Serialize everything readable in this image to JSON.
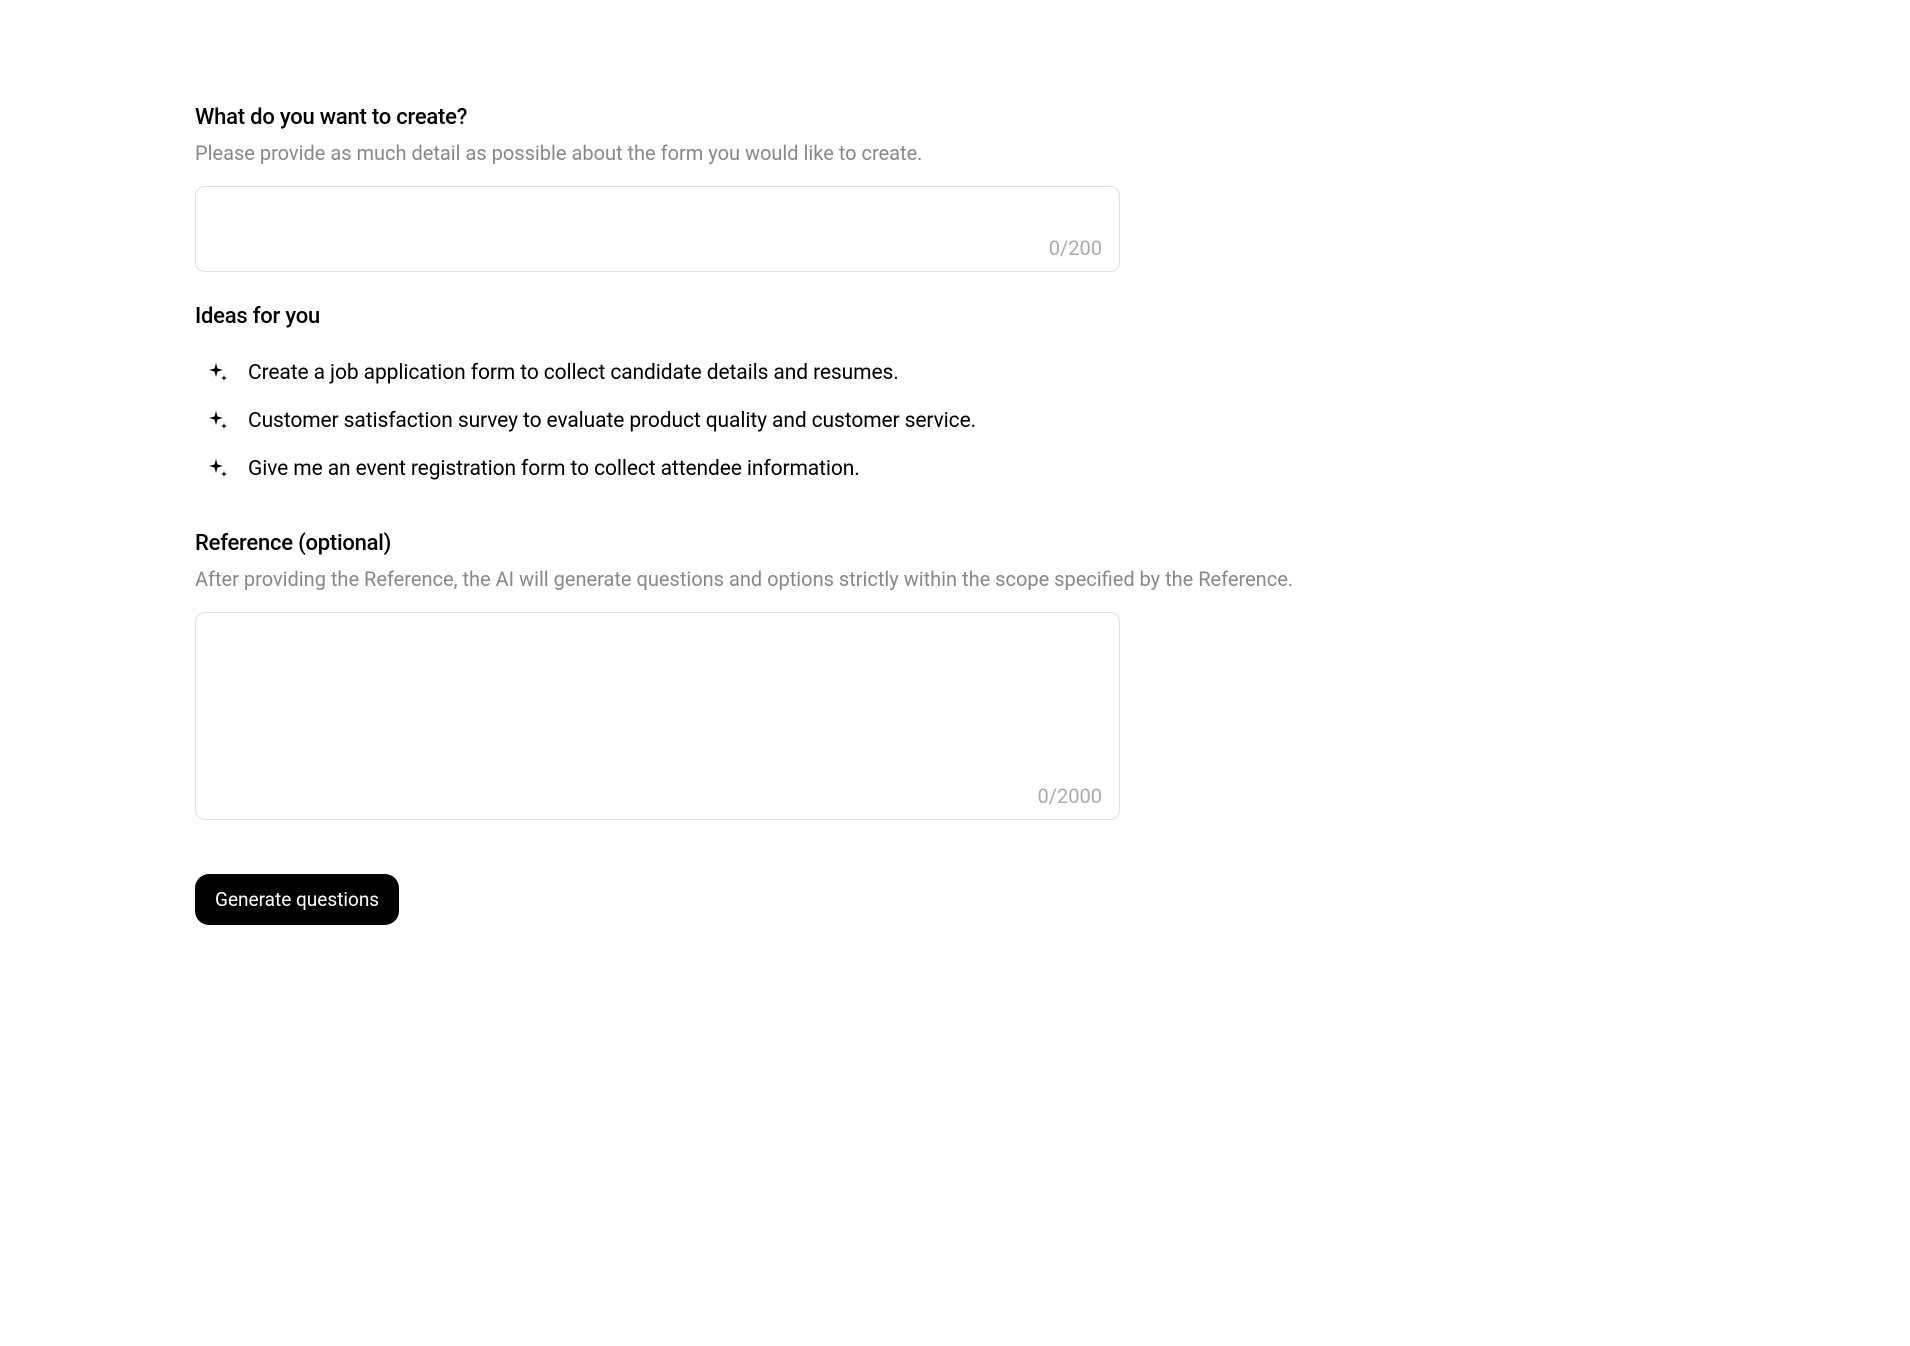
{
  "create": {
    "title": "What do you want to create?",
    "description": "Please provide as much detail as possible about the form you would like to create.",
    "counter": "0/200"
  },
  "ideas": {
    "title": "Ideas for you",
    "items": [
      {
        "text": "Create a job application form to collect candidate details and resumes."
      },
      {
        "text": "Customer satisfaction survey to evaluate product quality and customer service."
      },
      {
        "text": "Give me an event registration form to collect attendee information."
      }
    ]
  },
  "reference": {
    "title": "Reference (optional)",
    "description": "After providing the Reference, the AI will generate questions and options strictly within the scope specified by the Reference.",
    "counter": "0/2000"
  },
  "button": {
    "label": "Generate questions"
  }
}
